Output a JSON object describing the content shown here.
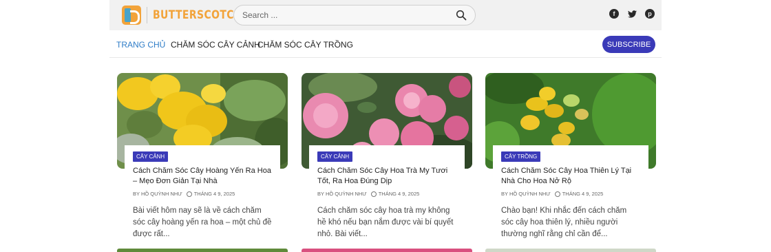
{
  "header": {
    "logo_text": "BUTTERSCOTCH",
    "search_placeholder": "Search ...",
    "social": [
      "facebook-icon",
      "twitter-icon",
      "pinterest-icon"
    ]
  },
  "nav": {
    "items": [
      "TRANG CHỦ",
      "CHĂM SÓC CÂY CẢNH",
      "CHĂM SÓC CÂY TRỒNG"
    ],
    "active_index": 0,
    "subscribe_label": "SUBSCRIBE"
  },
  "colors": {
    "accent": "#3a3ab8",
    "nav_active": "#2e7cc7",
    "logo": "#f2a33a"
  },
  "posts": [
    {
      "category": "CÂY CẢNH",
      "title": "Cách Chăm Sóc Cây Hoàng Yến Ra Hoa – Mẹo Đơn Giản Tại Nhà",
      "author": "BY HỒ QUỲNH NHƯ",
      "date": "THÁNG 4 9, 2025",
      "excerpt": "Bài viết hôm nay sẽ là về cách chăm sóc cây hoàng yến ra hoa – một chủ đề được rất...",
      "image": "yellow-flowers"
    },
    {
      "category": "CÂY CẢNH",
      "title": "Cách Chăm Sóc Cây Hoa Trà My Tươi Tốt, Ra Hoa Đúng Dịp",
      "author": "BY HỒ QUỲNH NHƯ",
      "date": "THÁNG 4 9, 2025",
      "excerpt": "Cách chăm sóc cây hoa trà my không hề khó nếu bạn nắm được vài bí quyết nhỏ. Bài viết...",
      "image": "pink-camellia"
    },
    {
      "category": "CÂY TRỒNG",
      "title": "Cách Chăm Sóc Cây Hoa Thiên Lý Tại Nhà Cho Hoa Nở Rộ",
      "author": "BY HỒ QUỲNH NHƯ",
      "date": "THÁNG 4 9, 2025",
      "excerpt": "Chào bạn! Khi nhắc đến cách chăm sóc cây hoa thiên lý, nhiều người thường nghĩ rằng chỉ cần để...",
      "image": "thien-ly-flowers"
    }
  ]
}
